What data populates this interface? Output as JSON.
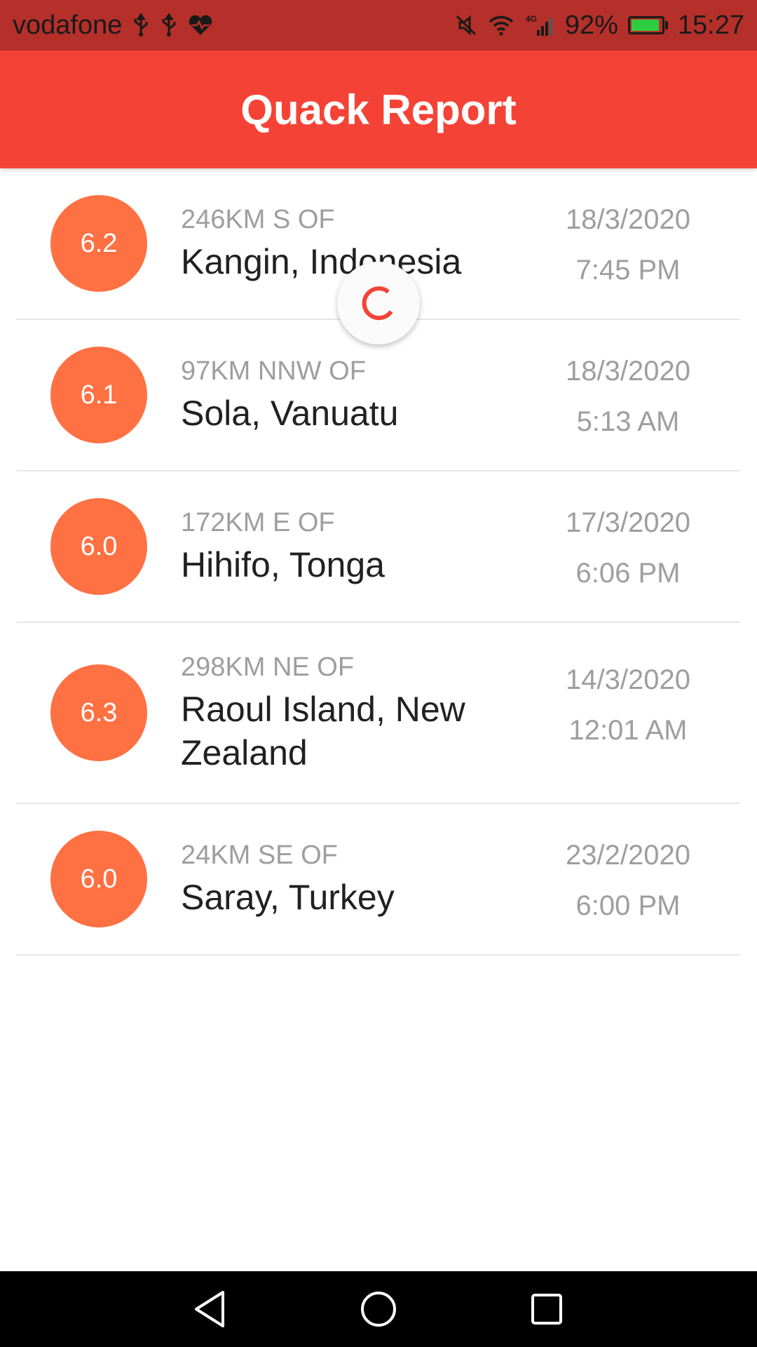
{
  "status_bar": {
    "carrier": "vodafone",
    "network": "4G",
    "battery": "92%",
    "battery_level": 0.92,
    "time": "15:27",
    "icons": [
      "usb-icon",
      "usb-icon",
      "heartbeat-icon",
      "mute-icon",
      "wifi-icon",
      "signal-icon",
      "battery-icon"
    ]
  },
  "app_bar": {
    "title": "Quack Report"
  },
  "colors": {
    "status_bar": "#b5302a",
    "app_bar": "#f44336",
    "magnitude": "#ff7043",
    "spinner": "#f44336"
  },
  "quakes": [
    {
      "magnitude": "6.2",
      "offset": "246KM S OF",
      "place": " Kangin, Indonesia",
      "date": "18/3/2020",
      "time": "7:45 PM"
    },
    {
      "magnitude": "6.1",
      "offset": "97KM NNW OF",
      "place": " Sola, Vanuatu",
      "date": "18/3/2020",
      "time": "5:13 AM"
    },
    {
      "magnitude": "6.0",
      "offset": "172KM E OF",
      "place": " Hihifo, Tonga",
      "date": "17/3/2020",
      "time": "6:06 PM"
    },
    {
      "magnitude": "6.3",
      "offset": "298KM NE OF",
      "place": " Raoul Island, New Zealand",
      "date": "14/3/2020",
      "time": "12:01 AM"
    },
    {
      "magnitude": "6.0",
      "offset": "24KM SE OF",
      "place": " Saray, Turkey",
      "date": "23/2/2020",
      "time": "6:00 PM"
    }
  ],
  "nav_bar": {
    "buttons": [
      "back-icon",
      "home-icon",
      "recents-icon"
    ]
  }
}
